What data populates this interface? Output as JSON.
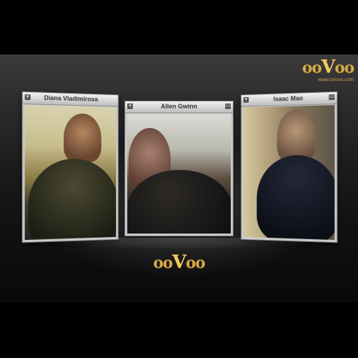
{
  "brand": {
    "logo_parts": [
      "oo",
      "V",
      "oo"
    ],
    "url": "www.oovoo.com"
  },
  "participants": [
    {
      "name": "Diana Vladimirova"
    },
    {
      "name": "Allen Gwinn"
    },
    {
      "name": "Isaac Mao"
    }
  ],
  "window_controls": {
    "menu_icon": "▾",
    "minimize_icon": "▭"
  },
  "colors": {
    "brand_gold": "#d4a84b",
    "panel_title": "#333333",
    "background": "#000000"
  }
}
